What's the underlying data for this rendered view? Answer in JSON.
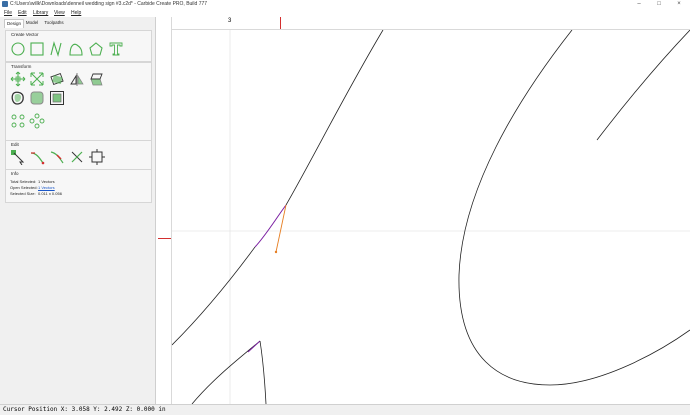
{
  "window": {
    "title": "C:\\Users\\willk\\Downloads\\denneil wedding sign #3.c2d* - Carbide Create PRO, Build 777",
    "controls": [
      "minimize-icon",
      "maximize-icon",
      "close-icon"
    ]
  },
  "menu": {
    "items": [
      {
        "label": "File"
      },
      {
        "label": "Edit"
      },
      {
        "label": "Library"
      },
      {
        "label": "View"
      },
      {
        "label": "Help"
      }
    ]
  },
  "tabs": [
    {
      "label": "Design",
      "active": true
    },
    {
      "label": "Model",
      "active": false
    },
    {
      "label": "Toolpaths",
      "active": false
    }
  ],
  "create_vector": {
    "title": "Create Vector",
    "tools": [
      "circle-icon",
      "rectangle-icon",
      "polyline-icon",
      "curve-icon",
      "polygon-icon",
      "text-icon"
    ]
  },
  "transform": {
    "title": "Transform",
    "tools": [
      "move-icon",
      "scale-icon",
      "rotate-icon",
      "mirror-icon",
      "shear-icon",
      "offset-icon",
      "fillet-icon",
      "boolean-icon",
      "array-grid-icon",
      "circular-array-icon"
    ]
  },
  "edit": {
    "title": "Edit",
    "tools": [
      "node-edit-icon",
      "trim-icon",
      "join-icon",
      "split-icon",
      "bounding-box-icon"
    ]
  },
  "info": {
    "title": "Info",
    "rows": [
      {
        "label": "Total Selected:",
        "value": "1 Vectors",
        "link": false
      },
      {
        "label": "Open Selected:",
        "value": "1 Vectors",
        "link": true
      },
      {
        "label": "Selected Size:",
        "value": "0.011 x 0.056",
        "link": false
      }
    ]
  },
  "ruler": {
    "h_label": "3"
  },
  "colors": {
    "panel_bg": "#f0f0f0",
    "tool_green": "#4caf50",
    "selected_path": "#7b1fa2",
    "node_orange": "#e67e22",
    "ruler_marker": "#d32f2f"
  },
  "status": {
    "text": "Cursor Position X: 3.058 Y: 2.492 Z: 0.000 in"
  }
}
